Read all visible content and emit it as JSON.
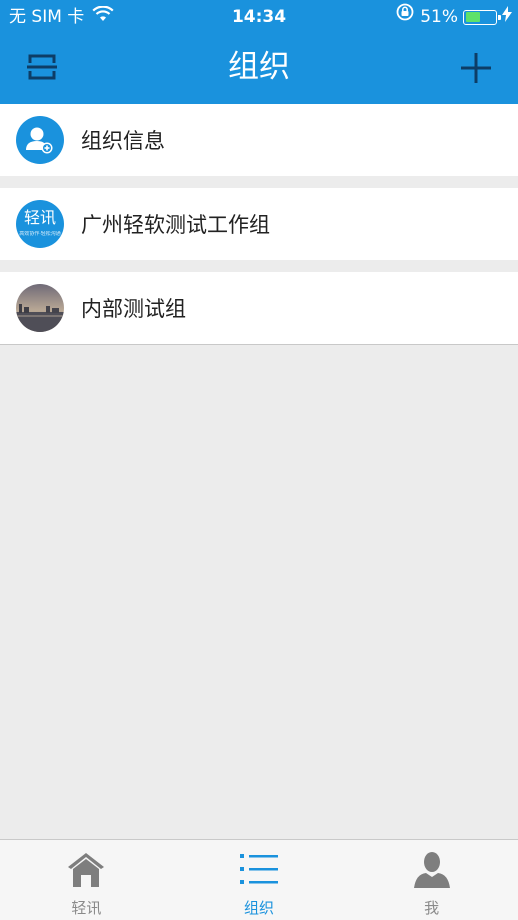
{
  "status_bar": {
    "carrier": "无 SIM 卡",
    "time": "14:34",
    "battery_percent": "51%",
    "battery_level": 0.51
  },
  "navbar": {
    "title": "组织",
    "left_icon": "scan-icon",
    "right_icon": "plus-icon"
  },
  "groups": [
    {
      "label": "组织信息",
      "icon": "org-info-icon"
    },
    {
      "label": "广州轻软测试工作组",
      "avatar_text": "轻讯",
      "avatar_subtext": "高效协作·轻松沟通"
    },
    {
      "label": "内部测试组",
      "avatar": "landscape-photo"
    }
  ],
  "tabbar": {
    "tabs": [
      {
        "label": "轻讯",
        "icon": "home-icon",
        "active": false
      },
      {
        "label": "组织",
        "icon": "list-icon",
        "active": true
      },
      {
        "label": "我",
        "icon": "person-icon",
        "active": false
      }
    ]
  },
  "colors": {
    "brand": "#1a92dd",
    "background": "#ececec",
    "battery": "#5ee26a"
  }
}
